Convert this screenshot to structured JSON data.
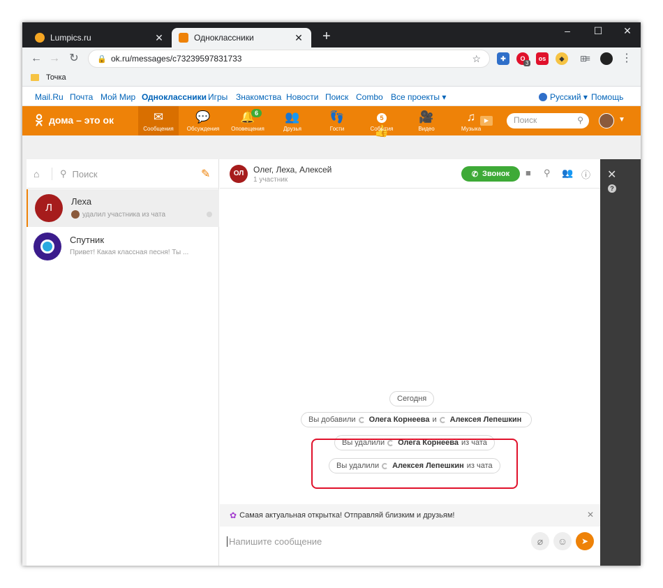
{
  "browser": {
    "tabs": [
      {
        "title": "Lumpics.ru",
        "active": false,
        "favicon_color": "#f5a623"
      },
      {
        "title": "Одноклассники",
        "active": true,
        "favicon_color": "#ee8208"
      }
    ],
    "url": "ok.ru/messages/c73239597831733",
    "bookmark": "Точка",
    "extension_badge": "3",
    "extension_labels": [
      "os"
    ]
  },
  "toplinks": {
    "items": [
      "Mail.Ru",
      "Почта",
      "Мой Мир",
      "Одноклассники",
      "Игры",
      "Знакомства",
      "Новости",
      "Поиск",
      "Combo",
      "Все проекты ▾"
    ],
    "language": "Русский ▾",
    "help": "Помощь"
  },
  "okbar": {
    "logo": "дома – это ок",
    "nav": [
      {
        "label": "Сообщения",
        "icon": "envelope-icon",
        "glyph": "✉",
        "active": true
      },
      {
        "label": "Обсуждения",
        "icon": "discussions-icon",
        "glyph": "💬"
      },
      {
        "label": "Оповещения",
        "icon": "bell-icon",
        "glyph": "🔔",
        "badge": "6"
      },
      {
        "label": "Друзья",
        "icon": "friends-icon",
        "glyph": "👥"
      },
      {
        "label": "Гости",
        "icon": "footprints-icon",
        "glyph": "👣"
      },
      {
        "label": "События",
        "icon": "events-icon",
        "glyph": "👍",
        "badge_inline": "5"
      },
      {
        "label": "Видео",
        "icon": "video-icon",
        "glyph": "🎥"
      },
      {
        "label": "Музыка",
        "icon": "music-icon",
        "glyph": "♫"
      }
    ],
    "search_placeholder": "Поиск"
  },
  "sidebar": {
    "search_placeholder": "Поиск",
    "chats": [
      {
        "name": "Леха",
        "initial": "Л",
        "preview": "удалил участника из чата",
        "avatar_color": "#a61c1c",
        "active": true
      },
      {
        "name": "Спутник",
        "initial": "",
        "preview": "Привет! Какая классная песня! Ты ...",
        "avatar_color": "#3b1c8c",
        "active": false
      }
    ]
  },
  "chat_header": {
    "initials": "ОЛ",
    "title": "Олег, Леха, Алексей",
    "subtitle": "1 участник",
    "call_label": "Звонок"
  },
  "messages": {
    "date": "Сегодня",
    "added": {
      "prefix": "Вы добавили",
      "user1": "Олега Корнеева",
      "joiner": "и",
      "user2": "Алексея Лепешкин"
    },
    "removed1": {
      "prefix": "Вы удалили",
      "user": "Олега Корнеева",
      "suffix": "из чата"
    },
    "removed2": {
      "prefix": "Вы удалили",
      "user": "Алексея Лепешкин",
      "suffix": "из чата"
    }
  },
  "promo": {
    "text": "Самая актуальная открытка! Отправляй близким и друзьям!"
  },
  "composer": {
    "placeholder": "Напишите сообщение"
  },
  "colors": {
    "ok_orange": "#ee8208",
    "call_green": "#3eaa37",
    "highlight_red": "#e0112b"
  }
}
